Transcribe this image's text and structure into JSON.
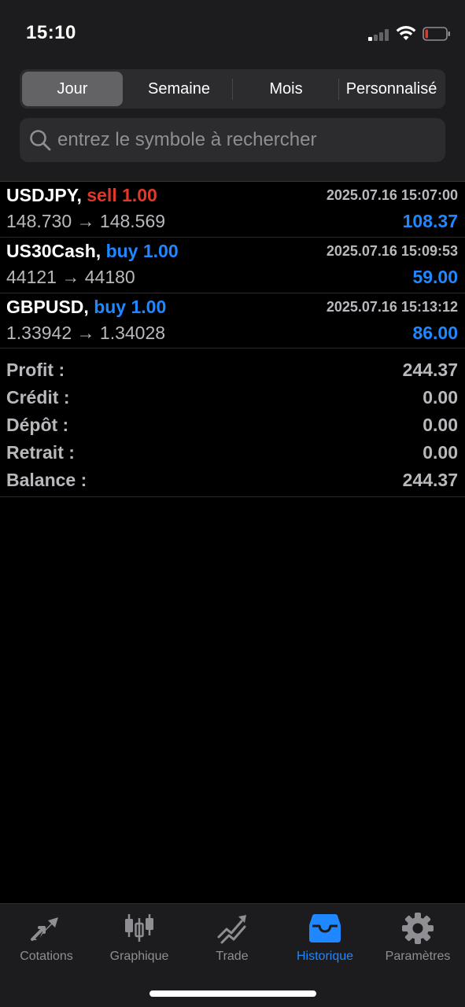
{
  "status_bar": {
    "time": "15:10"
  },
  "period_tabs": [
    {
      "label": "Jour",
      "active": true
    },
    {
      "label": "Semaine",
      "active": false
    },
    {
      "label": "Mois",
      "active": false
    },
    {
      "label": "Personnalisé",
      "active": false
    }
  ],
  "search": {
    "placeholder": "entrez le symbole à rechercher",
    "value": ""
  },
  "trades": [
    {
      "symbol": "USDJPY,",
      "side": "sell 1.00",
      "time": "2025.07.16 15:07:00",
      "prices": "148.730 → 148.569",
      "profit": "108.37"
    },
    {
      "symbol": "US30Cash,",
      "side": "buy 1.00",
      "time": "2025.07.16 15:09:53",
      "prices": "44121 → 44180",
      "profit": "59.00"
    },
    {
      "symbol": "GBPUSD,",
      "side": "buy 1.00",
      "time": "2025.07.16 15:13:12",
      "prices": "1.33942 → 1.34028",
      "profit": "86.00"
    }
  ],
  "summary": [
    {
      "label": "Profit :",
      "value": "244.37"
    },
    {
      "label": "Crédit :",
      "value": "0.00"
    },
    {
      "label": "Dépôt :",
      "value": "0.00"
    },
    {
      "label": "Retrait :",
      "value": "0.00"
    },
    {
      "label": "Balance :",
      "value": "244.37"
    }
  ],
  "tabbar": [
    {
      "label": "Cotations",
      "icon": "cotations-arrows-icon",
      "active": false
    },
    {
      "label": "Graphique",
      "icon": "candlestick-chart-icon",
      "active": false
    },
    {
      "label": "Trade",
      "icon": "trade-trend-icon",
      "active": false
    },
    {
      "label": "Historique",
      "icon": "inbox-tray-icon",
      "active": true
    },
    {
      "label": "Paramètres",
      "icon": "gear-icon",
      "active": false
    }
  ],
  "colors": {
    "accent": "#1f87ff",
    "sell": "#e0392b",
    "muted": "#b9b9bd",
    "background": "#000000",
    "panel": "#1c1c1e"
  }
}
